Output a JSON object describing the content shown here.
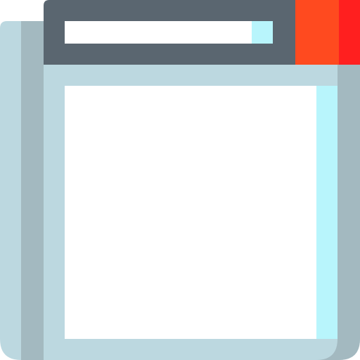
{
  "icon": {
    "name": "browser-window-icon",
    "colors": {
      "back_sheet_light": "#BCD8E0",
      "back_sheet_shadow": "#A3B9C0",
      "frame": "#BCD8E0",
      "frame_shadow": "#A3B9C0",
      "title_bar": "#5A6670",
      "address_bar": "#FFFFFF",
      "address_bar_end": "#B8F5FC",
      "close_button": "#FF4A1F",
      "close_button_shadow": "#FF1F1F",
      "content": "#FFFFFF",
      "content_shadow": "#B8F5FC"
    }
  }
}
